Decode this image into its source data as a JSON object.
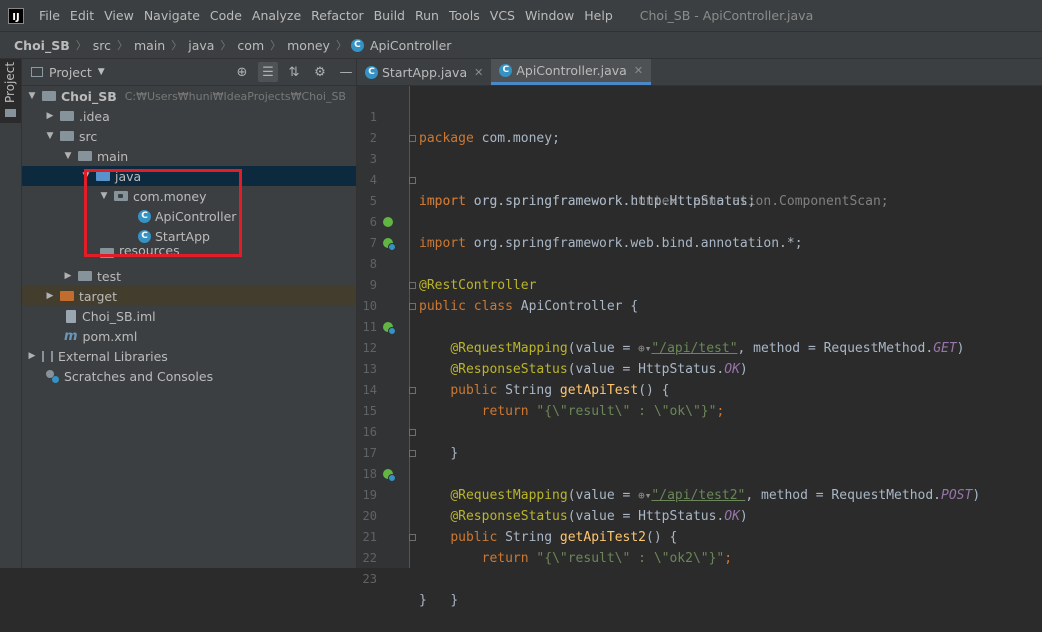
{
  "menubar": {
    "items": [
      "File",
      "Edit",
      "View",
      "Navigate",
      "Code",
      "Analyze",
      "Refactor",
      "Build",
      "Run",
      "Tools",
      "VCS",
      "Window",
      "Help"
    ],
    "window_title": "Choi_SB - ApiController.java"
  },
  "breadcrumb": [
    "Choi_SB",
    "src",
    "main",
    "java",
    "com",
    "money",
    "ApiController"
  ],
  "side_tab": "Project",
  "panel": {
    "title": "Project",
    "tree": [
      {
        "label": "Choi_SB",
        "path": "C:₩Users₩huni₩IdeaProjects₩Choi_SB"
      },
      {
        "label": ".idea"
      },
      {
        "label": "src"
      },
      {
        "label": "main"
      },
      {
        "label": "java"
      },
      {
        "label": "com.money"
      },
      {
        "label": "ApiController"
      },
      {
        "label": "StartApp"
      },
      {
        "label": "resources"
      },
      {
        "label": "test"
      },
      {
        "label": "target"
      },
      {
        "label": "Choi_SB.iml"
      },
      {
        "label": "pom.xml"
      },
      {
        "label": "External Libraries"
      },
      {
        "label": "Scratches and Consoles"
      }
    ]
  },
  "tabs": [
    {
      "label": "StartApp.java",
      "active": false
    },
    {
      "label": "ApiController.java",
      "active": true
    }
  ],
  "editor": {
    "line_numbers": [
      "1",
      "2",
      "3",
      "4",
      "5",
      "6",
      "7",
      "8",
      "9",
      "10",
      "11",
      "12",
      "13",
      "14",
      "15",
      "16",
      "17",
      "18",
      "19",
      "20",
      "21",
      "22",
      "23"
    ],
    "code": {
      "l1_kw": "package",
      "l1_rest": " com.money;",
      "l3_kw": "import",
      "l3_rest": " org.springframework.context.annotation.ComponentScan;",
      "l4_kw": "import",
      "l4_rest": " org.springframework.http.HttpStatus;",
      "l5_kw": "import",
      "l5_rest": " org.springframework.web.bind.annotation.*;",
      "l7_ann": "@RestController",
      "l8_kw": "public class",
      "l8_rest": " ApiController {",
      "l10_ann": "@RequestMapping",
      "l10_a": "(value = ",
      "l10_url": "\"/api/test\"",
      "l10_b": ", method = RequestMethod.",
      "l10_const": "GET",
      "l10_c": ")",
      "l11_ann": "@ResponseStatus",
      "l11_a": "(value = HttpStatus.",
      "l11_const": "OK",
      "l11_b": ")",
      "l12_kw": "public",
      "l12_a": " String ",
      "l12_fn": "getApiTest",
      "l12_b": "() {",
      "l14_kw": "return",
      "l14_str": " \"{\\\"result\\\" : \\\"ok\\\"}\"",
      "l14_a": ";",
      "l15": "}",
      "l17_ann": "@RequestMapping",
      "l17_a": "(value = ",
      "l17_url": "\"/api/test2\"",
      "l17_b": ", method = RequestMethod.",
      "l17_const": "POST",
      "l17_c": ")",
      "l18_ann": "@ResponseStatus",
      "l18_a": "(value = HttpStatus.",
      "l18_const": "OK",
      "l18_b": ")",
      "l19_kw": "public",
      "l19_a": " String ",
      "l19_fn": "getApiTest2",
      "l19_b": "() {",
      "l21_kw": "return",
      "l21_str": " \"{\\\"result\\\" : \\\"ok2\\\"}\"",
      "l21_a": ";",
      "l22": "}",
      "l23": "}"
    }
  },
  "colors": {
    "selection": "#0d293e",
    "highlight_box": "#e21d27",
    "keyword": "#cc7832",
    "annotation": "#bbb529",
    "string": "#6a8759"
  }
}
